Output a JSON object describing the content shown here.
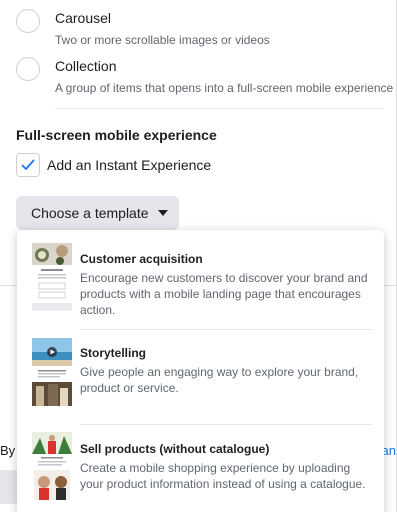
{
  "format_options": [
    {
      "title": "Carousel",
      "subtitle": "Two or more scrollable images or videos",
      "selected": false
    },
    {
      "title": "Collection",
      "subtitle": "A group of items that opens into a full-screen mobile experience",
      "selected": false
    }
  ],
  "fullscreen_section": {
    "title": "Full-screen mobile experience",
    "checkbox_label": "Add an Instant Experience",
    "checked": true
  },
  "template_button": {
    "label": "Choose a template"
  },
  "templates": [
    {
      "title": "Customer acquisition",
      "description": "Encourage new customers to discover your brand and products with a mobile landing page that encourages action."
    },
    {
      "title": "Storytelling",
      "description": "Give people an engaging way to explore your brand, product or service."
    },
    {
      "title": "Sell products (without catalogue)",
      "description": "Create a mobile shopping experience by uploading your product information instead of using a catalogue."
    }
  ],
  "background_text": {
    "left": "By",
    "right": "an"
  },
  "colors": {
    "accent": "#1877f2",
    "button_bg": "#e4e6eb",
    "text_secondary": "#606770"
  }
}
